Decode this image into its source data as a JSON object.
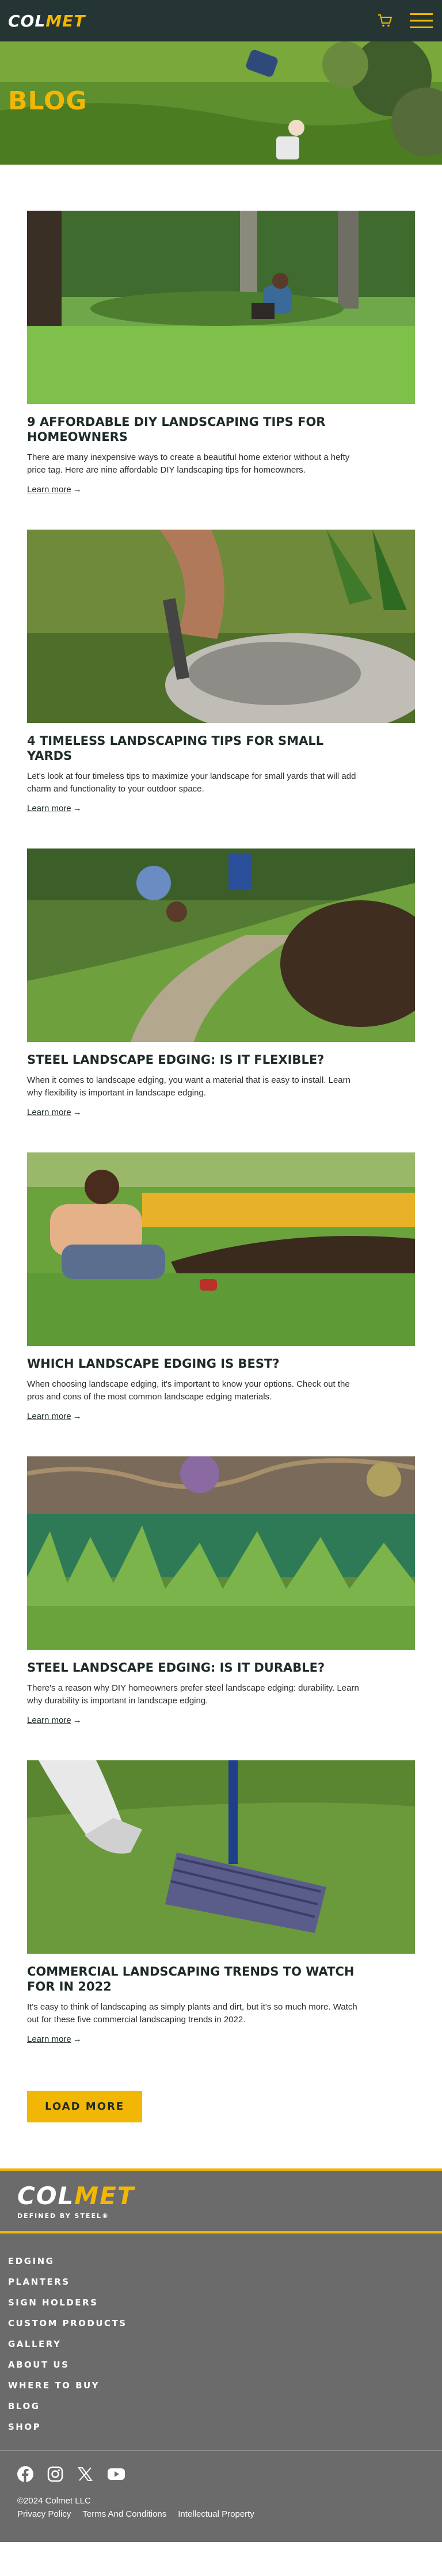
{
  "header": {
    "logo_part1": "COL",
    "logo_part2": "MET",
    "cart_icon": "cart-icon",
    "menu_icon": "hamburger-menu-icon"
  },
  "hero": {
    "title": "BLOG"
  },
  "posts": [
    {
      "title": "9 AFFORDABLE DIY LANDSCAPING TIPS FOR HOMEOWNERS",
      "excerpt": "There are many inexpensive ways to create a beautiful home exterior without a hefty price tag. Here are nine affordable DIY landscaping tips for homeowners.",
      "link_label": "Learn more"
    },
    {
      "title": "4 TIMELESS LANDSCAPING TIPS FOR SMALL YARDS",
      "excerpt": "Let's look at four timeless tips to maximize your landscape for small yards that will add charm and functionality to your outdoor space.",
      "link_label": "Learn more"
    },
    {
      "title": "STEEL LANDSCAPE EDGING: IS IT FLEXIBLE?",
      "excerpt": "When it comes to landscape edging, you want a material that is easy to install. Learn why flexibility is important in landscape edging.",
      "link_label": "Learn more"
    },
    {
      "title": "WHICH LANDSCAPE EDGING IS BEST?",
      "excerpt": "When choosing landscape edging, it's important to know your options. Check out the pros and cons of the most common landscape edging materials.",
      "link_label": "Learn more"
    },
    {
      "title": "STEEL LANDSCAPE EDGING: IS IT DURABLE?",
      "excerpt": "There's a reason why DIY homeowners prefer steel landscape edging: durability. Learn why durability is important in landscape edging.",
      "link_label": "Learn more"
    },
    {
      "title": "COMMERCIAL LANDSCAPING TRENDS TO WATCH FOR IN 2022",
      "excerpt": "It's easy to think of landscaping as simply plants and dirt, but it's so much more. Watch out for these five commercial landscaping trends in 2022.",
      "link_label": "Learn more"
    }
  ],
  "load_more_label": "LOAD MORE",
  "footer": {
    "logo_part1": "COL",
    "logo_part2": "MET",
    "tagline": "DEFINED BY STEEL®",
    "nav": [
      "EDGING",
      "PLANTERS",
      "SIGN HOLDERS",
      "CUSTOM PRODUCTS",
      "GALLERY",
      "ABOUT US",
      "WHERE TO BUY",
      "BLOG",
      "SHOP"
    ],
    "social_icons": [
      "facebook-icon",
      "instagram-icon",
      "x-twitter-icon",
      "youtube-icon"
    ],
    "copyright": "©2024 Colmet LLC",
    "legal": [
      "Privacy Policy",
      "Terms And Conditions",
      "Intellectual Property"
    ]
  },
  "colors": {
    "header_bg": "#243534",
    "accent": "#f2b705",
    "footer_bg": "#6b6b6b"
  }
}
